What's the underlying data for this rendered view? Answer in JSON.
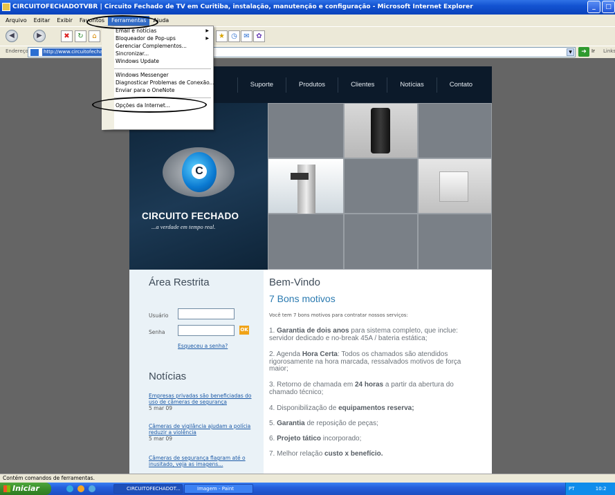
{
  "window": {
    "title": "CIRCUITOFECHADOTVBR | Circuito Fechado de TV em Curitiba, instalação, manutenção e configuração - Microsoft Internet Explorer",
    "min": "_",
    "max": "□"
  },
  "menubar": {
    "items": [
      "Arquivo",
      "Editar",
      "Exibir",
      "Favoritos",
      "Ferramentas",
      "Ajuda"
    ]
  },
  "addressbar": {
    "label": "Endereço",
    "url": "http://www.circuitofechado",
    "go_label": "Ir",
    "links_label": "Links"
  },
  "tools_menu": {
    "items": [
      {
        "label": "Email e notícias",
        "submenu": true
      },
      {
        "label": "Bloqueador de Pop-ups",
        "submenu": true
      },
      {
        "label": "Gerenciar Complementos...",
        "submenu": false
      },
      {
        "label": "Sincronizar...",
        "submenu": false
      },
      {
        "label": "Windows Update",
        "submenu": false
      },
      {
        "label": "Windows Messenger",
        "submenu": false
      },
      {
        "label": "Diagnosticar Problemas de Conexão...",
        "submenu": false
      },
      {
        "label": "Enviar para o OneNote",
        "submenu": false
      },
      {
        "label": "Opções da Internet...",
        "submenu": false
      }
    ]
  },
  "site": {
    "nav": [
      "Suporte",
      "Produtos",
      "Clientes",
      "Notícias",
      "Contato"
    ],
    "logo_title": "CIRCUITO FECHADO",
    "logo_tagline": "...a verdade em tempo real.",
    "restricted": {
      "title": "Área Restrita",
      "user_label": "Usuário",
      "password_label": "Senha",
      "ok_label": "OK",
      "forgot": "Esqueceu a senha?"
    },
    "news": {
      "title": "Notícias",
      "items": [
        {
          "text": "Empresas privadas são beneficiadas do uso de câmeras de segurança",
          "date": "5 mar 09"
        },
        {
          "text": "Câmeras de vigilância ajudam a polícia reduzir a violência",
          "date": "5 mar 09"
        },
        {
          "text": "Câmeras de segurança flagram até o inusitado, veja as imagens...",
          "date": ""
        }
      ]
    },
    "welcome": {
      "title": "Bem-Vindo",
      "subtitle": "7 Bons motivos",
      "intro": "Você tem 7 bons motivos para contratar nossos serviços:",
      "r1_pre": "1. ",
      "r1_bold": "Garantia de dois anos",
      "r1_post": " para sistema completo, que inclue: servidor dedicado e no-break 45A / bateria estática;",
      "r2_pre": "2. Agenda ",
      "r2_bold": "Hora Certa",
      "r2_post": ": Todos os chamados são atendidos rigorosamente na hora marcada, ressalvados motivos de força maior;",
      "r3_pre": "3. Retorno de chamada em ",
      "r3_bold": "24 horas",
      "r3_post": " a partir da abertura do chamado técnico;",
      "r4_pre": "4. Disponibilização de ",
      "r4_bold": "equipamentos reserva;",
      "r5_pre": "5. ",
      "r5_bold": "Garantia",
      "r5_post": " de reposição de peças;",
      "r6_pre": "6. ",
      "r6_bold": "Projeto tático",
      "r6_post": " incorporado;",
      "r7_pre": "7. Melhor relação ",
      "r7_bold": "custo x benefício."
    }
  },
  "statusbar": {
    "text": "Contém comandos de ferramentas."
  },
  "taskbar": {
    "start": "Iniciar",
    "tasks": [
      "CIRCUITOFECHADOT...",
      "Imagem - Paint"
    ],
    "tray_lang": "PT",
    "clock": "10:2"
  }
}
